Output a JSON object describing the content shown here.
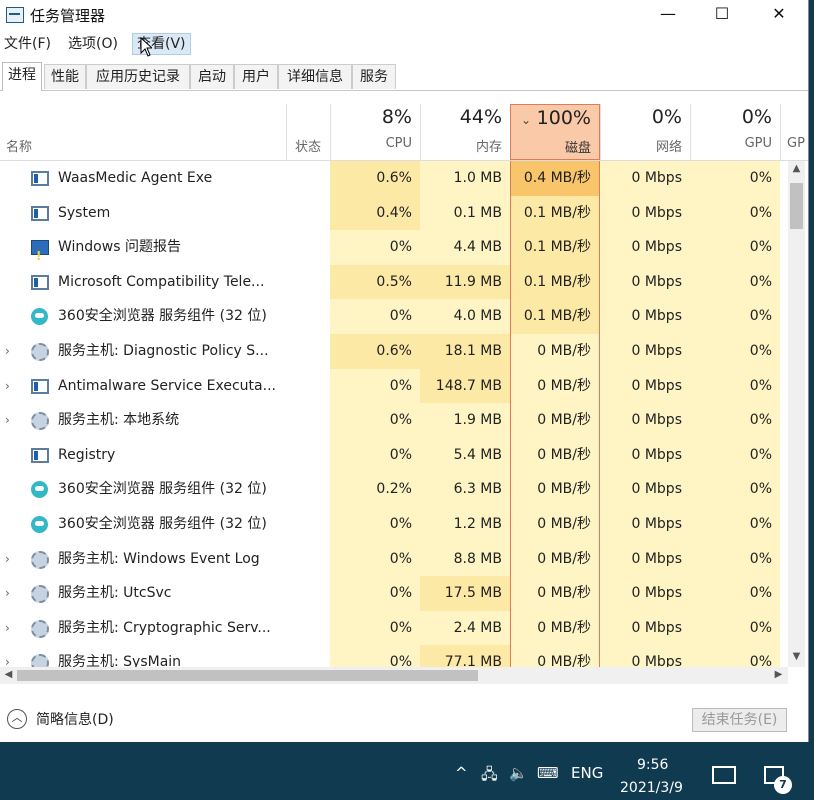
{
  "window": {
    "title": "任务管理器"
  },
  "window_buttons": {
    "minimize": "—",
    "maximize": "☐",
    "close": "✕"
  },
  "menu": [
    "文件(F)",
    "选项(O)",
    "查看(V)"
  ],
  "tabs": [
    "进程",
    "性能",
    "应用历史记录",
    "启动",
    "用户",
    "详细信息",
    "服务"
  ],
  "header": {
    "name_label": "名称",
    "status_label": "状态",
    "cpu_pct": "8%",
    "cpu_label": "CPU",
    "mem_pct": "44%",
    "mem_label": "内存",
    "disk_pct": "100%",
    "disk_label": "磁盘",
    "net_pct": "0%",
    "net_label": "网络",
    "gpu_pct": "0%",
    "gpu_label": "GPU",
    "gpu2_label": "GP",
    "sort_arrow": "⌄"
  },
  "rows": [
    {
      "name": "WaasMedic Agent Exe",
      "expand": false,
      "icon": "window",
      "cpu": "0.6%",
      "mem": "1.0 MB",
      "disk": "0.4 MB/秒",
      "net": "0 Mbps",
      "gpu": "0%"
    },
    {
      "name": "System",
      "expand": false,
      "icon": "window",
      "cpu": "0.4%",
      "mem": "0.1 MB",
      "disk": "0.1 MB/秒",
      "net": "0 Mbps",
      "gpu": "0%"
    },
    {
      "name": "Windows 问题报告",
      "expand": false,
      "icon": "report",
      "cpu": "0%",
      "mem": "4.4 MB",
      "disk": "0.1 MB/秒",
      "net": "0 Mbps",
      "gpu": "0%"
    },
    {
      "name": "Microsoft Compatibility Tele...",
      "expand": false,
      "icon": "window",
      "cpu": "0.5%",
      "mem": "11.9 MB",
      "disk": "0.1 MB/秒",
      "net": "0 Mbps",
      "gpu": "0%"
    },
    {
      "name": "360安全浏览器 服务组件 (32 位)",
      "expand": false,
      "icon": "browser",
      "cpu": "0%",
      "mem": "4.0 MB",
      "disk": "0.1 MB/秒",
      "net": "0 Mbps",
      "gpu": "0%"
    },
    {
      "name": "服务主机: Diagnostic Policy S...",
      "expand": true,
      "icon": "gear",
      "cpu": "0.6%",
      "mem": "18.1 MB",
      "disk": "0 MB/秒",
      "net": "0 Mbps",
      "gpu": "0%"
    },
    {
      "name": "Antimalware Service Executa...",
      "expand": true,
      "icon": "window",
      "cpu": "0%",
      "mem": "148.7 MB",
      "disk": "0 MB/秒",
      "net": "0 Mbps",
      "gpu": "0%"
    },
    {
      "name": "服务主机: 本地系统",
      "expand": true,
      "icon": "gear",
      "cpu": "0%",
      "mem": "1.9 MB",
      "disk": "0 MB/秒",
      "net": "0 Mbps",
      "gpu": "0%"
    },
    {
      "name": "Registry",
      "expand": false,
      "icon": "window",
      "cpu": "0%",
      "mem": "5.4 MB",
      "disk": "0 MB/秒",
      "net": "0 Mbps",
      "gpu": "0%"
    },
    {
      "name": "360安全浏览器 服务组件 (32 位)",
      "expand": false,
      "icon": "browser",
      "cpu": "0.2%",
      "mem": "6.3 MB",
      "disk": "0 MB/秒",
      "net": "0 Mbps",
      "gpu": "0%"
    },
    {
      "name": "360安全浏览器 服务组件 (32 位)",
      "expand": false,
      "icon": "browser",
      "cpu": "0%",
      "mem": "1.2 MB",
      "disk": "0 MB/秒",
      "net": "0 Mbps",
      "gpu": "0%"
    },
    {
      "name": "服务主机: Windows Event Log",
      "expand": true,
      "icon": "gear",
      "cpu": "0%",
      "mem": "8.8 MB",
      "disk": "0 MB/秒",
      "net": "0 Mbps",
      "gpu": "0%"
    },
    {
      "name": "服务主机: UtcSvc",
      "expand": true,
      "icon": "gear",
      "cpu": "0%",
      "mem": "17.5 MB",
      "disk": "0 MB/秒",
      "net": "0 Mbps",
      "gpu": "0%"
    },
    {
      "name": "服务主机: Cryptographic Serv...",
      "expand": true,
      "icon": "gear",
      "cpu": "0%",
      "mem": "2.4 MB",
      "disk": "0 MB/秒",
      "net": "0 Mbps",
      "gpu": "0%"
    },
    {
      "name": "服务主机: SysMain",
      "expand": true,
      "icon": "gear",
      "cpu": "0%",
      "mem": "77.1 MB",
      "disk": "0 MB/秒",
      "net": "0 Mbps",
      "gpu": "0%"
    }
  ],
  "footer": {
    "collapse_label": "简略信息(D)",
    "end_task": "结束任务(E)"
  },
  "taskbar": {
    "tray_chevron": "^",
    "lang": "ENG",
    "time": "9:56",
    "date": "2021/3/9",
    "notif_count": "7"
  },
  "colors": {
    "heat_light": "#fff4c4",
    "heat_mid": "#fde9a6",
    "heat_strong": "#f9c56a",
    "disk_header": "#f9c9a8",
    "disk_border": "#e07a5f"
  }
}
